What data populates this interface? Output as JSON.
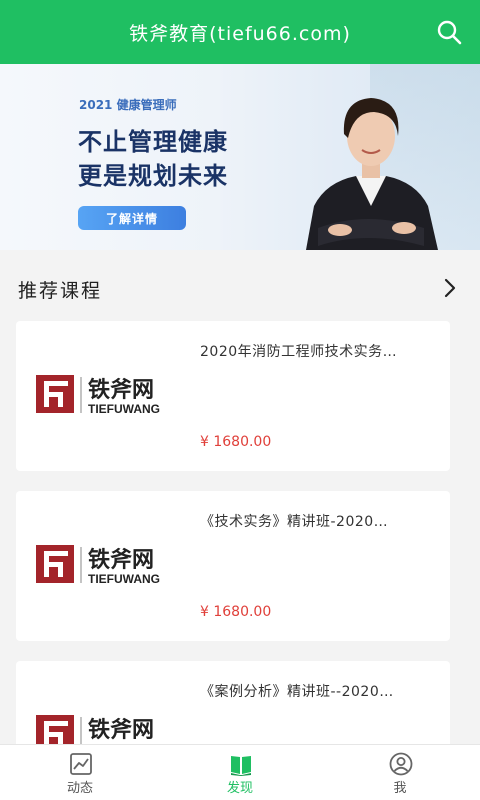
{
  "header": {
    "title": "铁斧教育(tiefu66.com)",
    "search_icon": "search-icon"
  },
  "banner": {
    "tag": "2021 健康管理师",
    "line1": "不止管理健康",
    "line2": "更是规划未来",
    "button": "了解详情"
  },
  "section": {
    "title": "推荐课程",
    "more_icon": "chevron-right-icon"
  },
  "brand": {
    "cn": "铁斧网",
    "en": "TIEFUWANG"
  },
  "courses": [
    {
      "title": "2020年消防工程师技术实务…",
      "price": "¥ 1680.00"
    },
    {
      "title": "《技术实务》精讲班-2020…",
      "price": "¥ 1680.00"
    },
    {
      "title": "《案例分析》精讲班--2020…",
      "price": ""
    }
  ],
  "tabbar": {
    "items": [
      {
        "label": "动态",
        "icon": "chart-icon"
      },
      {
        "label": "发现",
        "icon": "book-icon"
      },
      {
        "label": "我",
        "icon": "user-icon"
      }
    ],
    "active_index": 1
  },
  "colors": {
    "primary": "#1fbf62",
    "price": "#e0403a",
    "brand_red": "#a3242a"
  }
}
